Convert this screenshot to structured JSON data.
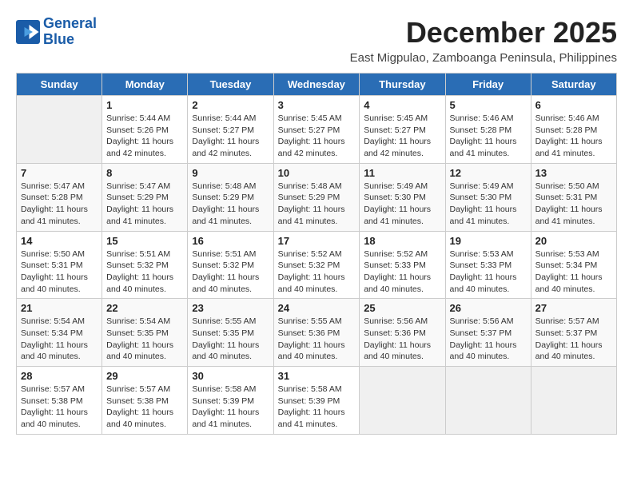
{
  "header": {
    "logo_line1": "General",
    "logo_line2": "Blue",
    "month": "December 2025",
    "location": "East Migpulao, Zamboanga Peninsula, Philippines"
  },
  "days_of_week": [
    "Sunday",
    "Monday",
    "Tuesday",
    "Wednesday",
    "Thursday",
    "Friday",
    "Saturday"
  ],
  "weeks": [
    [
      {
        "day": "",
        "info": ""
      },
      {
        "day": "1",
        "info": "Sunrise: 5:44 AM\nSunset: 5:26 PM\nDaylight: 11 hours\nand 42 minutes."
      },
      {
        "day": "2",
        "info": "Sunrise: 5:44 AM\nSunset: 5:27 PM\nDaylight: 11 hours\nand 42 minutes."
      },
      {
        "day": "3",
        "info": "Sunrise: 5:45 AM\nSunset: 5:27 PM\nDaylight: 11 hours\nand 42 minutes."
      },
      {
        "day": "4",
        "info": "Sunrise: 5:45 AM\nSunset: 5:27 PM\nDaylight: 11 hours\nand 42 minutes."
      },
      {
        "day": "5",
        "info": "Sunrise: 5:46 AM\nSunset: 5:28 PM\nDaylight: 11 hours\nand 41 minutes."
      },
      {
        "day": "6",
        "info": "Sunrise: 5:46 AM\nSunset: 5:28 PM\nDaylight: 11 hours\nand 41 minutes."
      }
    ],
    [
      {
        "day": "7",
        "info": "Sunrise: 5:47 AM\nSunset: 5:28 PM\nDaylight: 11 hours\nand 41 minutes."
      },
      {
        "day": "8",
        "info": "Sunrise: 5:47 AM\nSunset: 5:29 PM\nDaylight: 11 hours\nand 41 minutes."
      },
      {
        "day": "9",
        "info": "Sunrise: 5:48 AM\nSunset: 5:29 PM\nDaylight: 11 hours\nand 41 minutes."
      },
      {
        "day": "10",
        "info": "Sunrise: 5:48 AM\nSunset: 5:29 PM\nDaylight: 11 hours\nand 41 minutes."
      },
      {
        "day": "11",
        "info": "Sunrise: 5:49 AM\nSunset: 5:30 PM\nDaylight: 11 hours\nand 41 minutes."
      },
      {
        "day": "12",
        "info": "Sunrise: 5:49 AM\nSunset: 5:30 PM\nDaylight: 11 hours\nand 41 minutes."
      },
      {
        "day": "13",
        "info": "Sunrise: 5:50 AM\nSunset: 5:31 PM\nDaylight: 11 hours\nand 41 minutes."
      }
    ],
    [
      {
        "day": "14",
        "info": "Sunrise: 5:50 AM\nSunset: 5:31 PM\nDaylight: 11 hours\nand 40 minutes."
      },
      {
        "day": "15",
        "info": "Sunrise: 5:51 AM\nSunset: 5:32 PM\nDaylight: 11 hours\nand 40 minutes."
      },
      {
        "day": "16",
        "info": "Sunrise: 5:51 AM\nSunset: 5:32 PM\nDaylight: 11 hours\nand 40 minutes."
      },
      {
        "day": "17",
        "info": "Sunrise: 5:52 AM\nSunset: 5:32 PM\nDaylight: 11 hours\nand 40 minutes."
      },
      {
        "day": "18",
        "info": "Sunrise: 5:52 AM\nSunset: 5:33 PM\nDaylight: 11 hours\nand 40 minutes."
      },
      {
        "day": "19",
        "info": "Sunrise: 5:53 AM\nSunset: 5:33 PM\nDaylight: 11 hours\nand 40 minutes."
      },
      {
        "day": "20",
        "info": "Sunrise: 5:53 AM\nSunset: 5:34 PM\nDaylight: 11 hours\nand 40 minutes."
      }
    ],
    [
      {
        "day": "21",
        "info": "Sunrise: 5:54 AM\nSunset: 5:34 PM\nDaylight: 11 hours\nand 40 minutes."
      },
      {
        "day": "22",
        "info": "Sunrise: 5:54 AM\nSunset: 5:35 PM\nDaylight: 11 hours\nand 40 minutes."
      },
      {
        "day": "23",
        "info": "Sunrise: 5:55 AM\nSunset: 5:35 PM\nDaylight: 11 hours\nand 40 minutes."
      },
      {
        "day": "24",
        "info": "Sunrise: 5:55 AM\nSunset: 5:36 PM\nDaylight: 11 hours\nand 40 minutes."
      },
      {
        "day": "25",
        "info": "Sunrise: 5:56 AM\nSunset: 5:36 PM\nDaylight: 11 hours\nand 40 minutes."
      },
      {
        "day": "26",
        "info": "Sunrise: 5:56 AM\nSunset: 5:37 PM\nDaylight: 11 hours\nand 40 minutes."
      },
      {
        "day": "27",
        "info": "Sunrise: 5:57 AM\nSunset: 5:37 PM\nDaylight: 11 hours\nand 40 minutes."
      }
    ],
    [
      {
        "day": "28",
        "info": "Sunrise: 5:57 AM\nSunset: 5:38 PM\nDaylight: 11 hours\nand 40 minutes."
      },
      {
        "day": "29",
        "info": "Sunrise: 5:57 AM\nSunset: 5:38 PM\nDaylight: 11 hours\nand 40 minutes."
      },
      {
        "day": "30",
        "info": "Sunrise: 5:58 AM\nSunset: 5:39 PM\nDaylight: 11 hours\nand 41 minutes."
      },
      {
        "day": "31",
        "info": "Sunrise: 5:58 AM\nSunset: 5:39 PM\nDaylight: 11 hours\nand 41 minutes."
      },
      {
        "day": "",
        "info": ""
      },
      {
        "day": "",
        "info": ""
      },
      {
        "day": "",
        "info": ""
      }
    ]
  ]
}
